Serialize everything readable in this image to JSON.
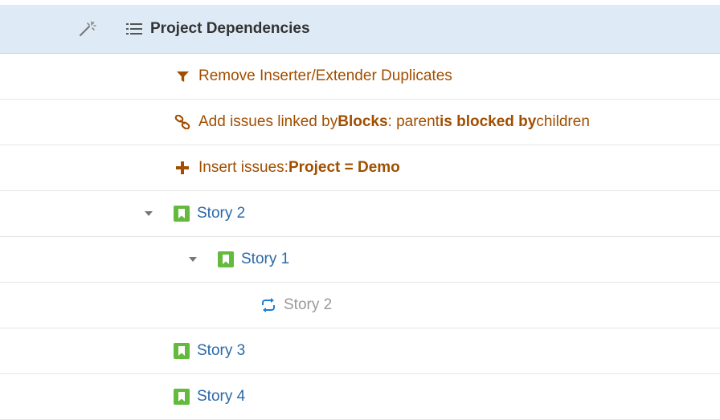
{
  "header": {
    "wand_icon": "magic-wand-icon",
    "structure_icon": "structure-list-icon",
    "title": "Project Dependencies"
  },
  "generators": [
    {
      "icon": "filter-icon",
      "text": "Remove Inserter/Extender Duplicates"
    },
    {
      "icon": "link-icon",
      "prefix": "Add issues linked by ",
      "link_type": "Blocks",
      "middle": ": parent ",
      "direction": "is blocked by",
      "suffix": " children"
    },
    {
      "icon": "plus-icon",
      "prefix": "Insert issues: ",
      "query": "Project = Demo"
    }
  ],
  "issues": [
    {
      "title": "Story 2",
      "toggle": "expanded",
      "icon": "story-icon"
    },
    {
      "title": "Story 1",
      "toggle": "expanded",
      "icon": "story-icon"
    },
    {
      "title": "Story 2",
      "icon": "cycle-icon",
      "duplicate": true
    },
    {
      "title": "Story 3",
      "icon": "story-icon"
    },
    {
      "title": "Story 4",
      "icon": "story-icon"
    }
  ],
  "colors": {
    "header_bg": "#deebf7",
    "generator_text": "#a14e00",
    "issue_link": "#2a69a8",
    "story_icon": "#63ba3c",
    "duplicate_text": "#999999",
    "cycle_icon": "#1c7cd6"
  }
}
